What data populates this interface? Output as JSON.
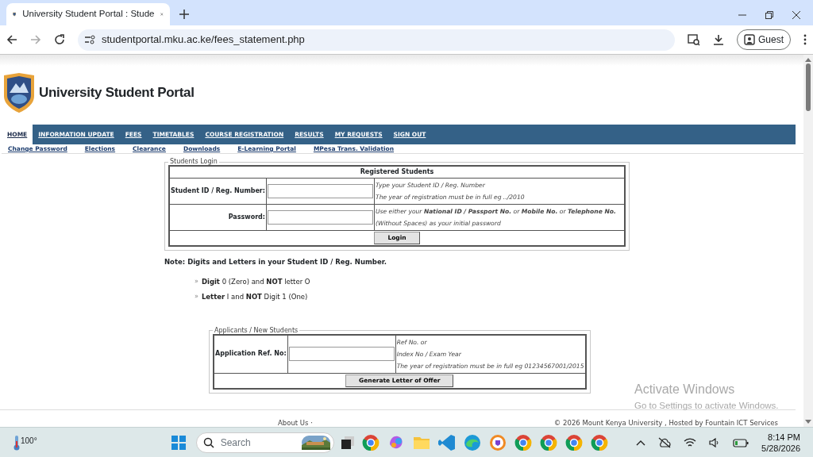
{
  "browser": {
    "tab_title": "University Student Portal : Stude",
    "url": "studentportal.mku.ac.ke/fees_statement.php",
    "profile": "Guest"
  },
  "portal": {
    "title": "University Student Portal",
    "nav": [
      {
        "label": "HOME",
        "selected": true
      },
      {
        "label": "INFORMATION UPDATE",
        "selected": false
      },
      {
        "label": "FEES",
        "selected": false
      },
      {
        "label": "TIMETABLES",
        "selected": false
      },
      {
        "label": "COURSE REGISTRATION",
        "selected": false
      },
      {
        "label": "RESULTS",
        "selected": false
      },
      {
        "label": "MY REQUESTS",
        "selected": false
      },
      {
        "label": "SIGN OUT",
        "selected": false
      }
    ],
    "subnav": [
      "Change Password",
      "Elections",
      "Clearance",
      "Downloads",
      "E-Learning Portal",
      "MPesa Trans. Validation"
    ],
    "login": {
      "legend": "Students Login",
      "heading": "Registered Students",
      "fields": [
        {
          "label": "Student ID / Reg. Number:",
          "hints": [
            "Type your Student ID / Reg. Number",
            "The year of registration must be in full eg ../2010"
          ]
        },
        {
          "label": "Password:",
          "hints": [
            "Use either your **National ID / Passport No.** or **Mobile No.** or **Telephone No.**",
            "(Without Spaces) as your initial password"
          ]
        }
      ],
      "button": "Login"
    },
    "note": "Note: Digits and Letters in your Student ID / Reg. Number.",
    "rules": [
      "**Digit** 0 (Zero) and **NOT** letter O",
      "**Letter** I and **NOT** Digit 1 (One)"
    ],
    "rule_marker": "»",
    "applicants": {
      "legend": "Applicants / New Students",
      "label": "Application Ref. No:",
      "hints": [
        "Ref No. or",
        "Index No / Exam Year",
        "The year of registration must be in full eg 01234567001/2015"
      ],
      "button": "Generate Letter of Offer"
    },
    "footer": {
      "about": "About Us ·",
      "copyright": "© 2026",
      "org": "Mount Kenya University",
      "hosted": ", Hosted by",
      "host": "Fountain ICT Services"
    }
  },
  "os_notice": {
    "title": "Activate Windows",
    "subtitle": "Go to Settings to activate Windows."
  },
  "taskbar": {
    "weather": "100°",
    "search_placeholder": "Search",
    "time": "8:14 PM",
    "date": "5/28/2026"
  }
}
